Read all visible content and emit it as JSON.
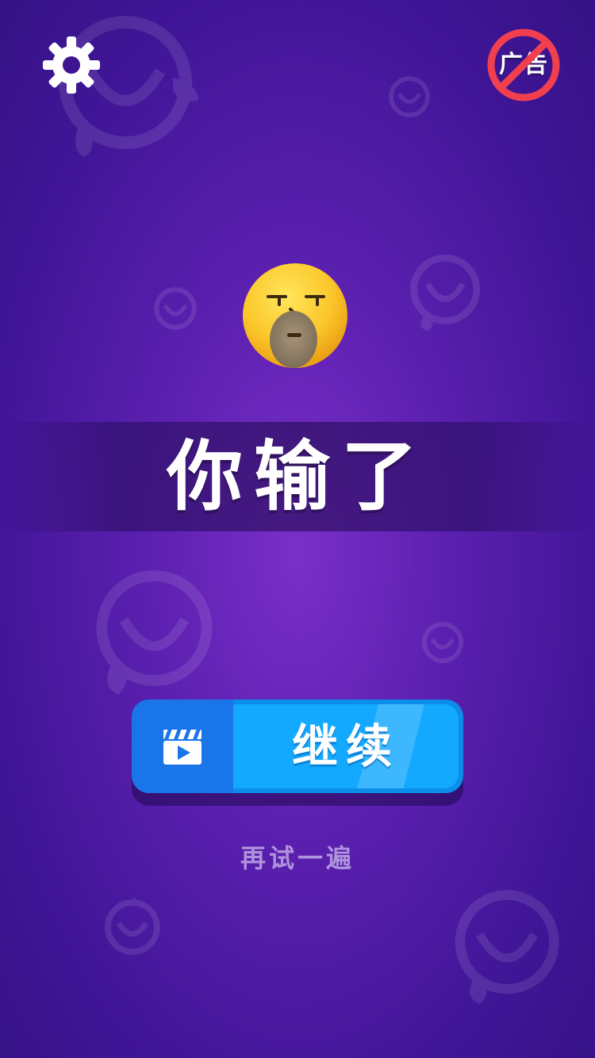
{
  "header": {
    "settings_icon": "gear-icon",
    "no_ads_icon": "no-ads-icon",
    "no_ads_label": "广告"
  },
  "result": {
    "face_icon": "sleeping-face-icon",
    "title": "你输了"
  },
  "actions": {
    "continue_icon": "video-clapper-icon",
    "continue_label": "继续",
    "retry_label": "再试一遍"
  },
  "colors": {
    "background": "#5a1fae",
    "button_primary": "#13a9ff",
    "button_secondary": "#1a76e8",
    "no_ads_red": "#f0404f"
  }
}
